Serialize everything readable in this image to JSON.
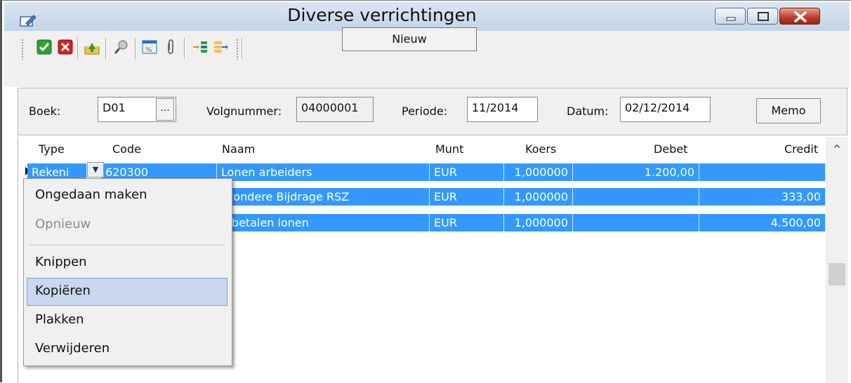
{
  "window": {
    "title": "Diverse verrichtingen"
  },
  "toolbar": {
    "icons": [
      "confirm-icon",
      "cancel-icon",
      "export-icon",
      "search-icon",
      "percent-icon",
      "attach-icon",
      "indent-icon",
      "outdent-icon"
    ],
    "new_label": "Nieuw"
  },
  "form": {
    "boek_label": "Boek:",
    "boek_value": "D01",
    "ellipsis": "...",
    "volgnummer_label": "Volgnummer:",
    "volgnummer_value": "04000001",
    "periode_label": "Periode:",
    "periode_value": "11/2014",
    "datum_label": "Datum:",
    "datum_value": "02/12/2014",
    "memo_label": "Memo"
  },
  "grid": {
    "columns": [
      "Type",
      "Code",
      "Naam",
      "Munt",
      "Koers",
      "Debet",
      "Credit"
    ],
    "rows": [
      {
        "type": "Rekeni",
        "code": "620300",
        "naam": "Lonen arbeiders",
        "munt": "EUR",
        "koers": "1,000000",
        "debet": "1.200,00",
        "credit": ""
      },
      {
        "type": "",
        "code": "",
        "naam": "ijzondere Bijdrage RSZ",
        "munt": "EUR",
        "koers": "1,000000",
        "debet": "",
        "credit": "333,00"
      },
      {
        "type": "",
        "code": "",
        "naam": "e betalen lonen",
        "munt": "EUR",
        "koers": "1,000000",
        "debet": "",
        "credit": "4.500,00"
      }
    ],
    "scroll_up": "^"
  },
  "context_menu": {
    "items": [
      {
        "label": "Ongedaan maken",
        "enabled": true
      },
      {
        "label": "Opnieuw",
        "enabled": false
      },
      {
        "label": "Knippen",
        "enabled": true
      },
      {
        "label": "Kopiëren",
        "enabled": true,
        "highlighted": true
      },
      {
        "label": "Plakken",
        "enabled": true
      },
      {
        "label": "Verwijderen",
        "enabled": true
      }
    ]
  },
  "colors": {
    "selection": "#3399ff",
    "menu_highlight": "#c9d8ee",
    "close_button": "#c0392b"
  }
}
